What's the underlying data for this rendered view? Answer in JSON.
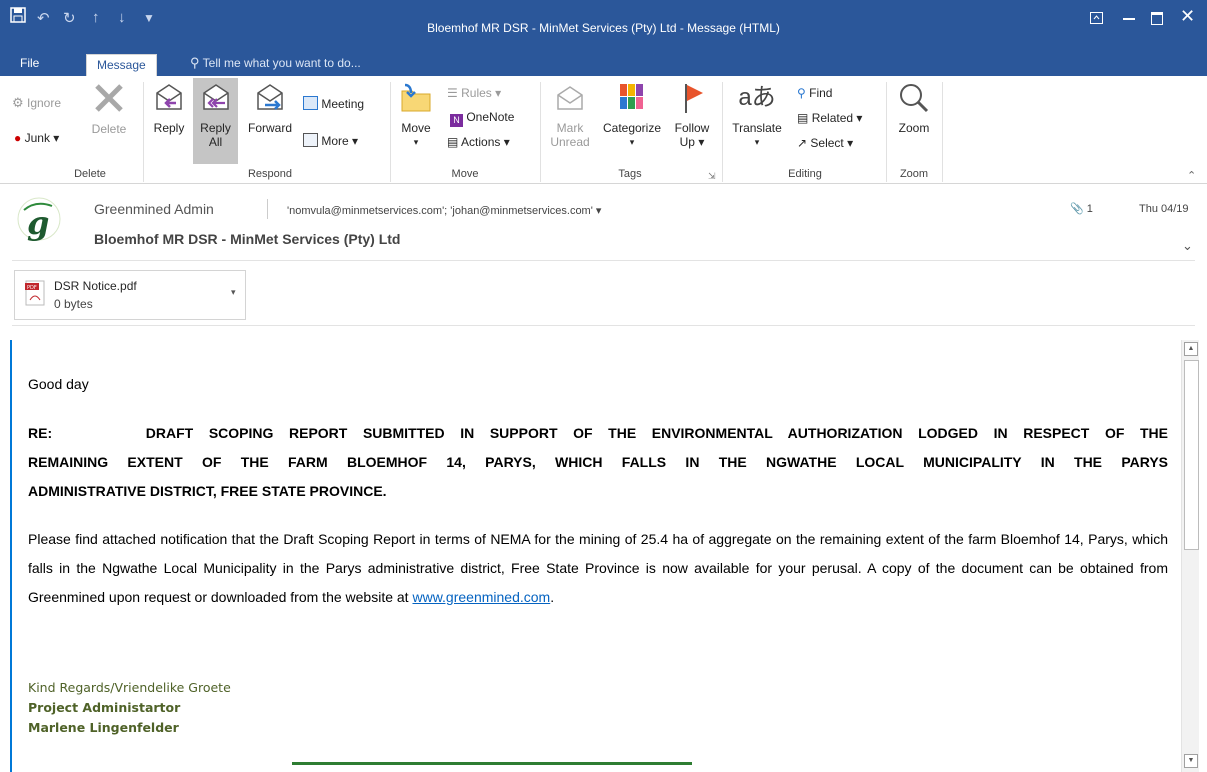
{
  "window": {
    "title": "Bloemhof MR DSR - MinMet Services (Pty) Ltd  -  Message (HTML)"
  },
  "tabs": {
    "file": "File",
    "message": "Message",
    "tell_me": "Tell me what you want to do..."
  },
  "ribbon": {
    "delete_group": {
      "label": "Delete",
      "ignore": "Ignore",
      "junk": "Junk",
      "delete": "Delete"
    },
    "respond_group": {
      "label": "Respond",
      "reply": "Reply",
      "reply_all_line1": "Reply",
      "reply_all_line2": "All",
      "forward": "Forward",
      "meeting": "Meeting",
      "more": "More"
    },
    "move_group": {
      "label": "Move",
      "move": "Move",
      "rules": "Rules",
      "onenote": "OneNote",
      "actions": "Actions"
    },
    "tags_group": {
      "label": "Tags",
      "mark_unread_line1": "Mark",
      "mark_unread_line2": "Unread",
      "categorize": "Categorize",
      "follow_up_line1": "Follow",
      "follow_up_line2": "Up"
    },
    "editing_group": {
      "label": "Editing",
      "translate": "Translate",
      "find": "Find",
      "related": "Related",
      "select": "Select"
    },
    "zoom_group": {
      "label": "Zoom",
      "zoom": "Zoom"
    }
  },
  "message": {
    "sender": "Greenmined Admin",
    "recipients": "'nomvula@minmetservices.com'; 'johan@minmetservices.com'",
    "subject": "Bloemhof MR DSR - MinMet Services (Pty) Ltd",
    "attachment_count": "1",
    "date": "Thu 04/19",
    "attachment": {
      "name": "DSR Notice.pdf",
      "size": "0 bytes"
    }
  },
  "body": {
    "greeting": "Good day",
    "re_label": "RE:",
    "re_line1": "DRAFT SCOPING REPORT SUBMITTED IN SUPPORT OF THE ENVIRONMENTAL AUTHORIZATION LODGED IN RESPECT OF THE",
    "re_line2": "REMAINING EXTENT OF THE FARM BLOEMHOF 14, PARYS, WHICH FALLS IN THE NGWATHE LOCAL MUNICIPALITY IN THE PARYS",
    "re_line3": "ADMINISTRATIVE DISTRICT, FREE STATE PROVINCE.",
    "paragraph": "Please find attached notification that the Draft Scoping Report in terms of NEMA for the mining of 25.4 ha of aggregate on the remaining extent of the farm Bloemhof 14, Parys, which falls in the Ngwathe Local Municipality in the Parys administrative district, Free State Province is now available for your perusal. A copy of the document can be obtained from Greenmined upon request or downloaded from the website at",
    "link": "www.greenmined.com",
    "link_suffix": ".",
    "sig_regards": "Kind Regards/Vriendelike Groete",
    "sig_title": "Project Administartor",
    "sig_name": "Marlene Lingenfelder"
  },
  "colors": {
    "title_bar": "#2b579a",
    "link": "#0563c1",
    "signature": "#4f6228"
  }
}
